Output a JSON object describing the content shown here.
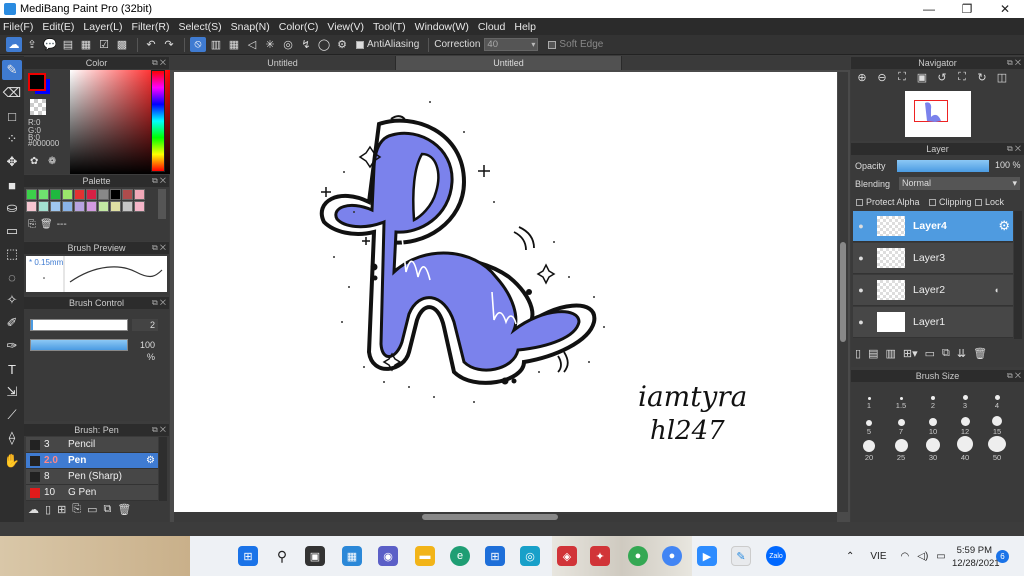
{
  "window": {
    "title": "MediBang Paint Pro (32bit)"
  },
  "menu": [
    "File(F)",
    "Edit(E)",
    "Layer(L)",
    "Filter(R)",
    "Select(S)",
    "Snap(N)",
    "Color(C)",
    "View(V)",
    "Tool(T)",
    "Window(W)",
    "Cloud",
    "Help"
  ],
  "options": {
    "antialiasing_label": "AntiAliasing",
    "correction_label": "Correction",
    "correction_value": "40",
    "soft_edge_label": "Soft Edge"
  },
  "color_panel": {
    "title": "Color",
    "r": "R:0",
    "g": "G:0",
    "b": "B:0",
    "hex": "#000000",
    "foreground": "#000000",
    "background": "#0000ff"
  },
  "palette": {
    "title": "Palette",
    "swatches": [
      "#3cd14a",
      "#6fe36f",
      "#1fb83f",
      "#9be56b",
      "#e33131",
      "#d71f45",
      "#888888",
      "#000000",
      "#b04c4c",
      "#f0a8b8",
      "#f6c6d1",
      "#a3e0d0",
      "#9fc7f0",
      "#8ab4e8",
      "#b8a3e0",
      "#d39be0",
      "#c3e8a3",
      "#e0e0a3",
      "#c6c6c6",
      "#f5b5c8"
    ],
    "extra": "---"
  },
  "brush_preview": {
    "title": "Brush Preview",
    "size": "* 0.15mm"
  },
  "brush_control": {
    "title": "Brush Control",
    "size_value": "2",
    "opacity_value": "100 %",
    "size_fill": 0.02,
    "opacity_fill": 1.0
  },
  "brush": {
    "title": "Brush: Pen",
    "items": [
      {
        "num": "3",
        "name": "Pencil",
        "color": "#222222"
      },
      {
        "num": "2.0",
        "name": "Pen",
        "color": "#222222"
      },
      {
        "num": "8",
        "name": "Pen (Sharp)",
        "color": "#222222"
      },
      {
        "num": "10",
        "name": "G Pen",
        "color": "#e01b1b"
      }
    ]
  },
  "tabs": [
    "Untitled",
    "Untitled"
  ],
  "navigator": {
    "title": "Navigator"
  },
  "layer_panel": {
    "title": "Layer",
    "opacity_label": "Opacity",
    "opacity_value": "100 %",
    "blending_label": "Blending",
    "blending_value": "Normal",
    "protect_alpha": "Protect Alpha",
    "clipping": "Clipping",
    "lock": "Lock",
    "layers": [
      "Layer4",
      "Layer3",
      "Layer2",
      "Layer1"
    ]
  },
  "brush_size": {
    "title": "Brush Size",
    "sizes": [
      "1",
      "1.5",
      "2",
      "3",
      "4",
      "5",
      "7",
      "10",
      "12",
      "15",
      "20",
      "25",
      "30",
      "40",
      "50"
    ]
  },
  "canvas": {
    "signature_line1": "iamtyra",
    "signature_line2": "hl247"
  },
  "taskbar": {
    "lang": "VIE",
    "time": "5:59 PM",
    "date": "12/28/2021",
    "notifications": "6",
    "zalo_label": "Zalo"
  }
}
